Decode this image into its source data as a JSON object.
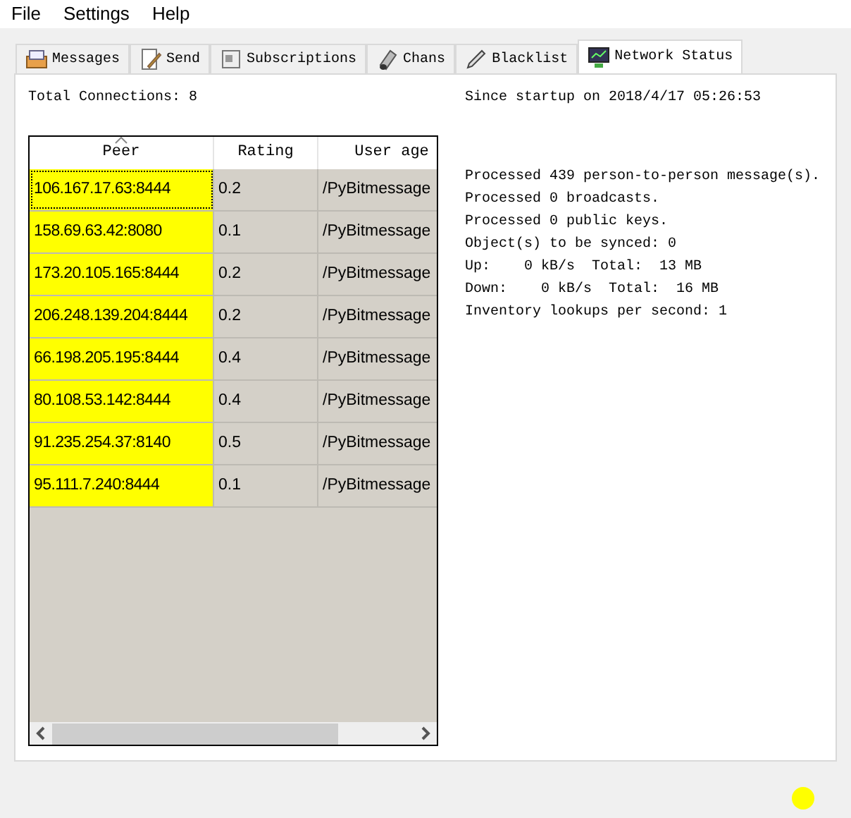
{
  "menu": [
    "File",
    "Settings",
    "Help"
  ],
  "tabs": [
    {
      "label": "Messages",
      "selected": false
    },
    {
      "label": "Send",
      "selected": false
    },
    {
      "label": "Subscriptions",
      "selected": false
    },
    {
      "label": "Chans",
      "selected": false
    },
    {
      "label": "Blacklist",
      "selected": false
    },
    {
      "label": "Network Status",
      "selected": true
    }
  ],
  "total_connections": "Total Connections: 8",
  "since_startup": "Since startup on 2018/4/17 05:26:53",
  "table": {
    "columns": [
      {
        "label": "Peer",
        "sorted": true
      },
      {
        "label": "Rating",
        "sorted": false
      },
      {
        "label": "User age",
        "sorted": false
      }
    ],
    "rows": [
      {
        "peer": "106.167.17.63:8444",
        "rating": "0.2",
        "agent": "/PyBitmessage",
        "color": "#ffff00",
        "focused": true
      },
      {
        "peer": "158.69.63.42:8080",
        "rating": "0.1",
        "agent": "/PyBitmessage",
        "color": "#ffff00",
        "focused": false
      },
      {
        "peer": "173.20.105.165:8444",
        "rating": "0.2",
        "agent": "/PyBitmessage",
        "color": "#ffff00",
        "focused": false
      },
      {
        "peer": "206.248.139.204:8444",
        "rating": "0.2",
        "agent": "/PyBitmessage",
        "color": "#ffff00",
        "focused": false
      },
      {
        "peer": "66.198.205.195:8444",
        "rating": "0.4",
        "agent": "/PyBitmessage",
        "color": "#ffff00",
        "focused": false
      },
      {
        "peer": "80.108.53.142:8444",
        "rating": "0.4",
        "agent": "/PyBitmessage",
        "color": "#ffff00",
        "focused": false
      },
      {
        "peer": "91.235.254.37:8140",
        "rating": "0.5",
        "agent": "/PyBitmessage",
        "color": "#ffff00",
        "focused": false
      },
      {
        "peer": "95.111.7.240:8444",
        "rating": "0.1",
        "agent": "/PyBitmessage",
        "color": "#ffff00",
        "focused": false
      }
    ]
  },
  "stats": [
    "Processed 439 person-to-person message(s).",
    "Processed 0 broadcasts.",
    "Processed 0 public keys.",
    "Object(s) to be synced: 0",
    "Up:    0 kB/s  Total:  13 MB",
    "Down:    0 kB/s  Total:  16 MB",
    "Inventory lookups per second: 1"
  ],
  "status_indicator": {
    "color": "#ffff00"
  }
}
